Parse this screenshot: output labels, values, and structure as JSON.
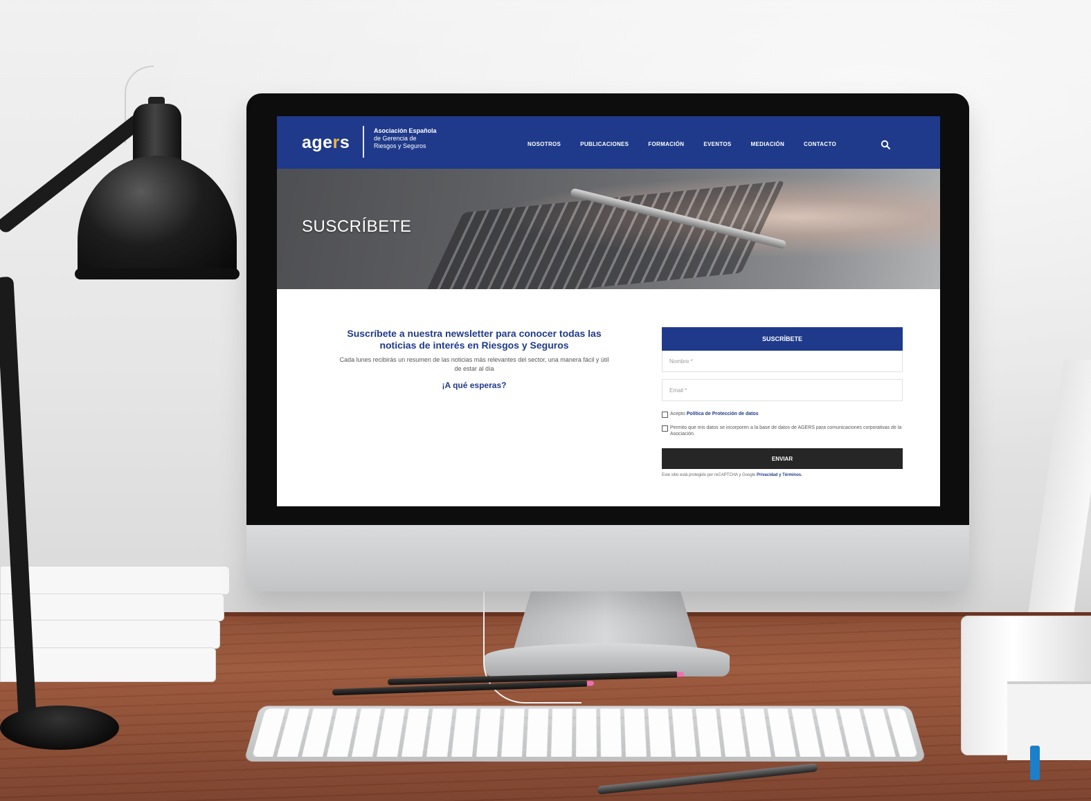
{
  "site": {
    "logo": {
      "prefix": "age",
      "accent": "r",
      "suffix": "s"
    },
    "logo_subtitle": [
      "Asociación Española",
      "de Gerencia de",
      "Riesgos y Seguros"
    ],
    "nav": [
      "NOSOTROS",
      "PUBLICACIONES",
      "FORMACIÓN",
      "EVENTOS",
      "MEDIACIÓN",
      "CONTACTO"
    ],
    "hero_title": "SUSCRÍBETE"
  },
  "content": {
    "headline": "Suscríbete a nuestra newsletter para conocer todas las noticias de interés en Riesgos y Seguros",
    "description": "Cada lunes recibirás un resumen de las noticias más relevantes del sector, una manera fácil y útil de estar al día",
    "cta": "¡A qué esperas?"
  },
  "form": {
    "header": "SUSCRÍBETE",
    "name_placeholder": "Nombre *",
    "email_placeholder": "Email *",
    "privacy_text": "Acepto",
    "privacy_link": "Política de Protección de datos",
    "consent_text": "Permito que mis datos se incorporen a la base de datos de AGERS para comunicaciones corporativas de la Asociación.",
    "submit": "ENVIAR",
    "recaptcha_text": "Este sitio está protegido por reCAPTCHA y Google",
    "recaptcha_links": "Privacidad y Términos."
  },
  "colors": {
    "brand_blue": "#1f3a8a",
    "accent_gold": "#f0b64a",
    "button_dark": "#262626"
  },
  "icons": [
    "search-icon"
  ]
}
